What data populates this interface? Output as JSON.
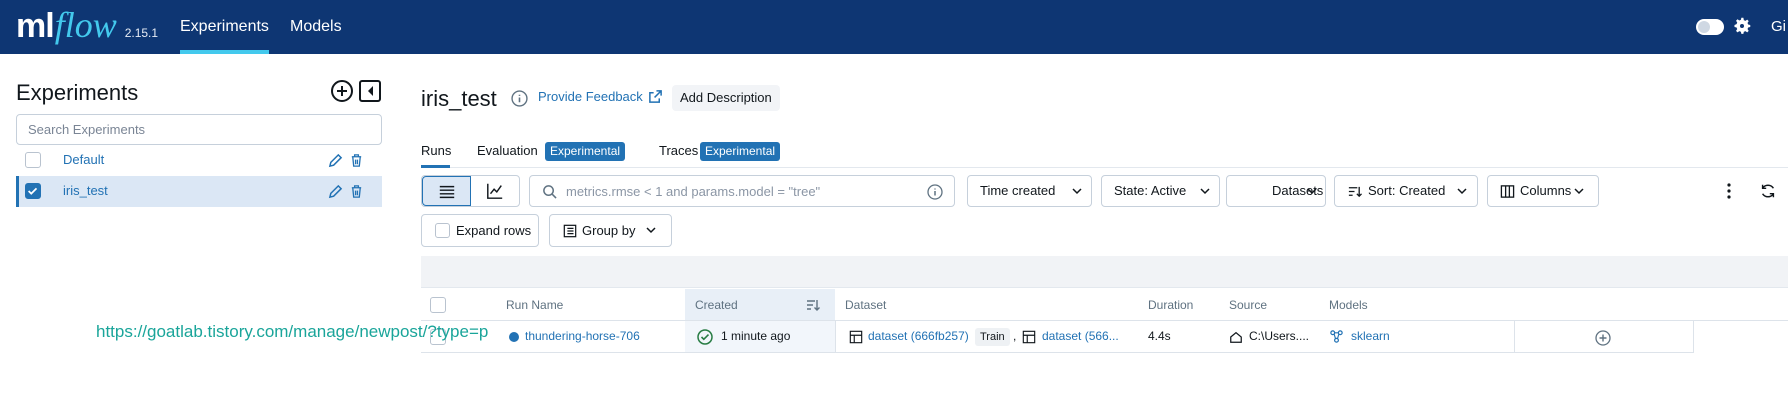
{
  "topbar": {
    "logo_ml": "ml",
    "logo_flow": "flow",
    "version": "2.15.1",
    "nav": [
      "Experiments",
      "Models"
    ],
    "right_text": "Gi",
    "bg_color": "#0e3673",
    "accent": "#43c9ed"
  },
  "sidebar": {
    "title": "Experiments",
    "search_placeholder": "Search Experiments",
    "experiments": [
      {
        "name": "Default",
        "checked": false
      },
      {
        "name": "iris_test",
        "checked": true
      }
    ]
  },
  "main": {
    "title": "iris_test",
    "feedback": "Provide Feedback",
    "add_description": "Add Description",
    "tabs": [
      {
        "label": "Runs",
        "active": true
      },
      {
        "label": "Evaluation",
        "badge": "Experimental"
      },
      {
        "label": "Traces",
        "badge": "Experimental"
      }
    ],
    "filter_placeholder": "metrics.rmse < 1 and params.model = \"tree\"",
    "dropdowns": {
      "time": "Time created",
      "state": "State: Active",
      "datasets": "Datasets",
      "sort": "Sort: Created",
      "columns": "Columns"
    },
    "expand_rows": "Expand rows",
    "group_by": "Group by"
  },
  "table": {
    "headers": [
      "Run Name",
      "Created",
      "Dataset",
      "Duration",
      "Source",
      "Models"
    ],
    "rows": [
      {
        "run_name": "thundering-horse-706",
        "created": "1 minute ago",
        "dataset1": "dataset (666fb257)",
        "dataset1_tag": "Train",
        "dataset_sep": ",",
        "dataset2": "dataset (566...",
        "duration": "4.4s",
        "source": "C:\\Users....",
        "model": "sklearn"
      }
    ]
  },
  "overlay": {
    "url": "https://goatlab.tistory.com/manage/newpost/?type=p"
  }
}
